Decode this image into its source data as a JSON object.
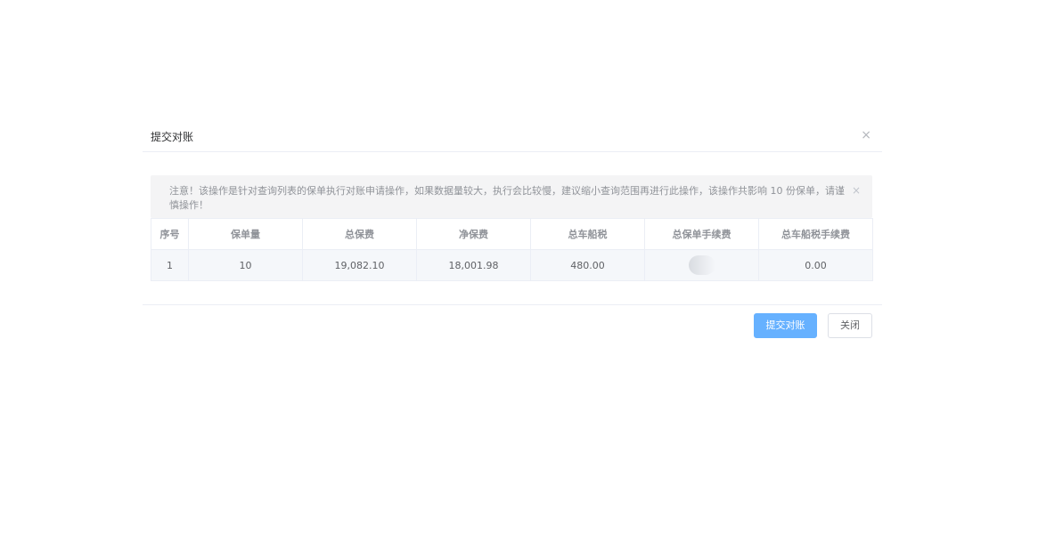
{
  "dialog": {
    "title": "提交对账",
    "close_icon": "×"
  },
  "alert": {
    "text": "注意！该操作是针对查询列表的保单执行对账申请操作，如果数据量较大，执行会比较慢，建议缩小查询范围再进行此操作，该操作共影响 10 份保单，请谨慎操作！",
    "close_icon": "×"
  },
  "table": {
    "headers": [
      "序号",
      "保单量",
      "总保费",
      "净保费",
      "总车船税",
      "总保单手续费",
      "总车船税手续费"
    ],
    "rows": [
      [
        "1",
        "10",
        "19,082.10",
        "18,001.98",
        "480.00",
        "",
        "0.00"
      ]
    ]
  },
  "footer": {
    "submit_label": "提交对账",
    "close_label": "关闭"
  },
  "colors": {
    "primary_button": "#66b1ff",
    "alert_bg": "#f4f4f5",
    "border": "#ebeef5"
  }
}
